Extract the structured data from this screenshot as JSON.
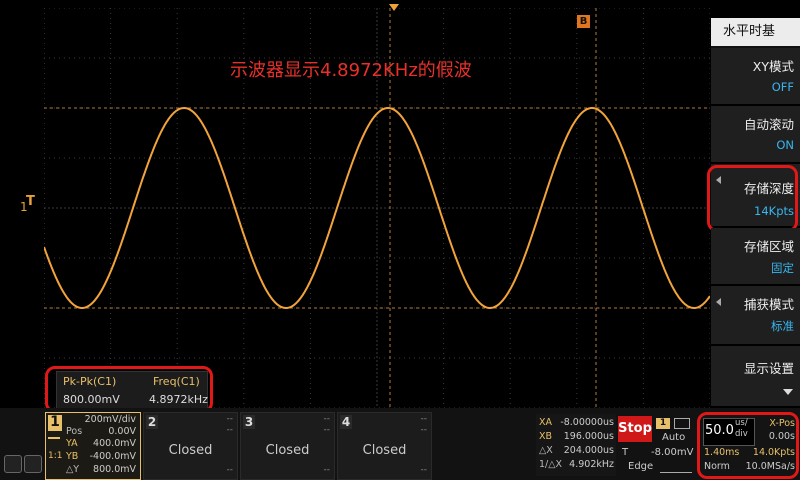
{
  "annotation": "示波器显示4.8972KHz的假波",
  "markers": {
    "b": "B",
    "ch1": "1",
    "trigger": "T"
  },
  "measurement": {
    "headers": [
      "Pk-Pk(C1)",
      "Freq(C1)"
    ],
    "values": [
      "800.00mV",
      "4.8972kHz"
    ]
  },
  "menu": {
    "title": "水平时基",
    "items": [
      {
        "label": "XY模式",
        "value": "OFF"
      },
      {
        "label": "自动滚动",
        "value": "ON"
      },
      {
        "label": "存储深度",
        "value": "14Kpts"
      },
      {
        "label": "存储区域",
        "value": "固定"
      },
      {
        "label": "捕获模式",
        "value": "标准"
      },
      {
        "label": "显示设置",
        "value": ""
      }
    ]
  },
  "ch1": {
    "num": "1",
    "scale": "200mV/div",
    "pos_label": "Pos",
    "pos": "0.00V",
    "ya_label": "YA",
    "ya": "400.0mV",
    "yb_label": "YB",
    "yb": "-400.0mV",
    "dy_label": "△Y",
    "dy": "800.0mV",
    "coupling": "1:1"
  },
  "channels": [
    {
      "num": "2",
      "status": "Closed",
      "dash": "--"
    },
    {
      "num": "3",
      "status": "Closed",
      "dash": "--"
    },
    {
      "num": "4",
      "status": "Closed",
      "dash": "--"
    }
  ],
  "cursors": {
    "xa_label": "XA",
    "xa": "-8.00000us",
    "xb_label": "XB",
    "xb": "196.000us",
    "dx_label": "△X",
    "dx": "204.000us",
    "inv_label": "1/△X",
    "inv": "4.902kHz"
  },
  "trigger": {
    "state": "Stop",
    "mode": "Auto",
    "t_label": "T",
    "t_value": "-8.00mV",
    "type": "Edge",
    "src": "1"
  },
  "timebase": {
    "value": "50.0",
    "unit_top": "us/",
    "unit_bottom": "div",
    "xpos_label": "X-Pos",
    "xpos": "0.00s",
    "time": "1.40ms",
    "pts": "14.0Kpts",
    "mode": "Norm",
    "rate": "10.0MSa/s"
  },
  "waveform": {
    "color": "#f2a43a",
    "grid_color": "#3a3a3a",
    "sample_count": 700
  }
}
